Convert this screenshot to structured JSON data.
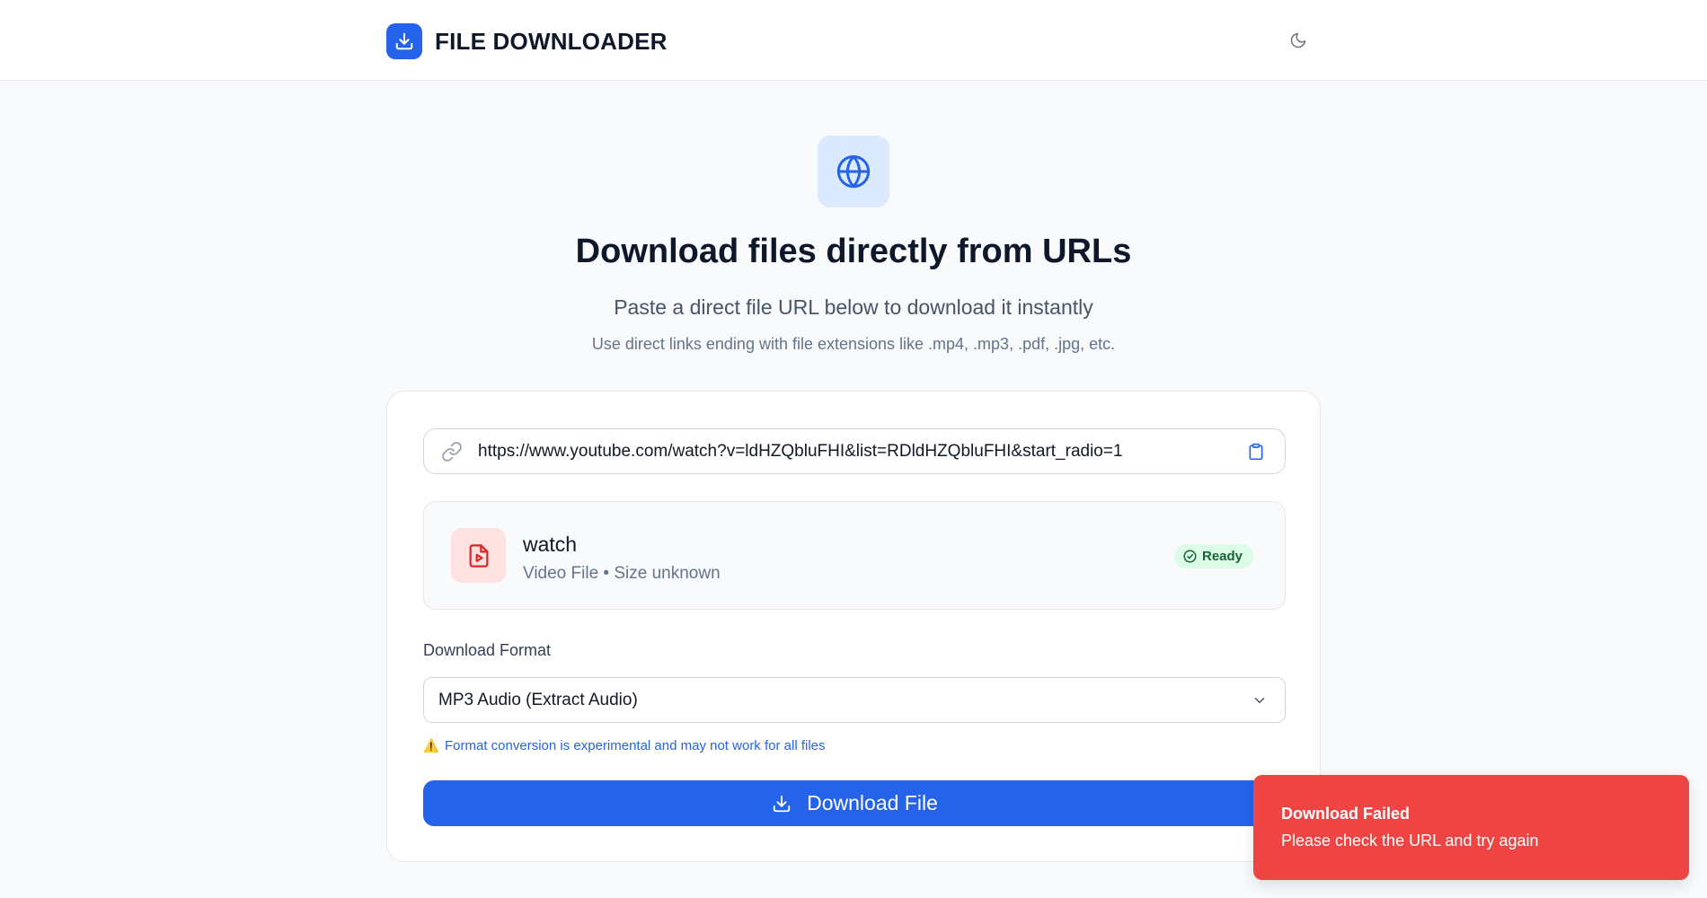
{
  "header": {
    "title": "FILE DOWNLOADER",
    "logo_icon": "download-icon",
    "theme_toggle_icon": "moon-icon"
  },
  "hero": {
    "icon": "globe-icon",
    "title": "Download files directly from URLs",
    "subtitle": "Paste a direct file URL below to download it instantly",
    "hint": "Use direct links ending with file extensions like .mp4, .mp3, .pdf, .jpg, etc."
  },
  "url_field": {
    "value": "https://www.youtube.com/watch?v=ldHZQbluFHI&list=RDldHZQbluFHI&start_radio=1",
    "icon": "link-icon",
    "paste_icon": "clipboard-icon"
  },
  "file_info": {
    "name": "watch",
    "meta": "Video File • Size unknown",
    "icon": "file-video-icon",
    "status": "Ready",
    "status_icon": "check-circle-icon"
  },
  "format": {
    "label": "Download Format",
    "selected": "MP3 Audio (Extract Audio)",
    "warning": "Format conversion is experimental and may not work for all files",
    "warning_icon": "⚠️"
  },
  "download_button": {
    "label": "Download File",
    "icon": "download-icon"
  },
  "toast": {
    "title": "Download Failed",
    "message": "Please check the URL and try again",
    "color": "#ef4444"
  },
  "colors": {
    "accent": "#2563eb",
    "background": "#f8fafc",
    "success_bg": "#dcfce7",
    "success_text": "#166534",
    "error": "#ef4444"
  }
}
